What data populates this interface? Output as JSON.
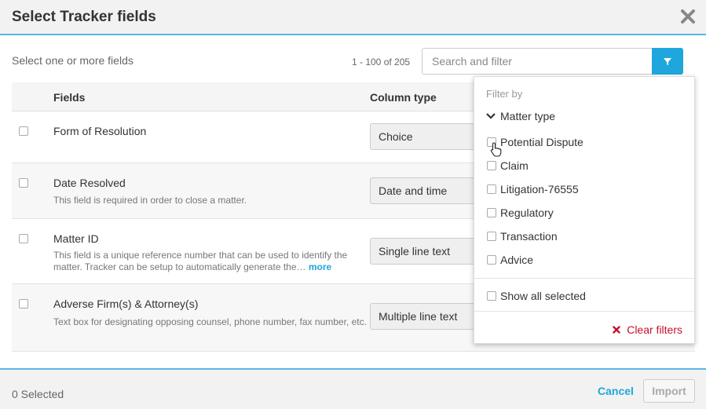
{
  "dialog": {
    "title": "Select Tracker fields"
  },
  "toolbar": {
    "subtitle": "Select one or more fields",
    "count": "1 - 100 of 205",
    "search_placeholder": "Search and filter"
  },
  "table": {
    "headers": [
      "Fields",
      "Column type"
    ],
    "rows": [
      {
        "name": "Form of Resolution",
        "description": "",
        "more": "",
        "type": "Choice"
      },
      {
        "name": "Date Resolved",
        "description": "This field is required in order to close a matter.",
        "more": "",
        "type": "Date and time"
      },
      {
        "name": "Matter ID",
        "description": "This field is a unique reference number that can be used to identify the matter. Tracker can be setup to automatically generate the…",
        "more": "more",
        "type": "Single line text"
      },
      {
        "name": "Adverse Firm(s) & Attorney(s)",
        "description": "Text box for designating opposing counsel, phone number, fax number, etc.",
        "more": "",
        "type": "Multiple line text"
      }
    ]
  },
  "filter": {
    "label": "Filter by",
    "group": "Matter type",
    "options": [
      "Potential Dispute",
      "Claim",
      "Litigation-76555",
      "Regulatory",
      "Transaction",
      "Advice"
    ],
    "show_all": "Show all selected",
    "clear": "Clear filters"
  },
  "footer": {
    "selected": "0 Selected",
    "cancel": "Cancel",
    "import": "Import"
  },
  "colors": {
    "accent": "#1fa6dd",
    "header_border": "#5bb5e3",
    "clear": "#c8102e"
  }
}
